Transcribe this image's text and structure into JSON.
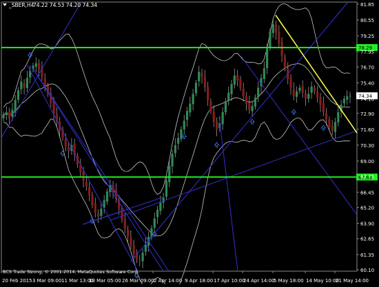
{
  "header": {
    "symbol_label": "_SBER,H4",
    "ohlc_label": "74.22 74.53 74.20 74.34",
    "menu_icon": "triangle-down-icon"
  },
  "footer": {
    "copyright": "BCS Trade Strong, © 2001-2014, MetaQuotes Software Corp."
  },
  "colors": {
    "background": "#000000",
    "frame": "#8a8a8a",
    "axis_text": "#ffffff",
    "bull_candle": "#2e8b57",
    "bear_candle": "#8b1a1a",
    "bollinger": "#c8c8c8",
    "fractal_arrow": "#3a6ad8",
    "trendline": "#3232d0",
    "level_line": "#22ee22",
    "level_label_bg": "#22ee22",
    "yellow_line": "#f3f34a",
    "price_label_bg": "#ffffff"
  },
  "chart_data": {
    "type": "candlestick",
    "symbol": "_SBER",
    "timeframe": "H4",
    "ylim": [
      60.1,
      81.9
    ],
    "y_ticks": [
      81.85,
      80.55,
      79.25,
      77.95,
      76.7,
      75.4,
      74.1,
      72.9,
      71.6,
      70.3,
      69.0,
      67.75,
      66.45,
      65.2,
      63.9,
      62.65,
      61.35,
      60.1
    ],
    "x_ticks": [
      "20 Feb 2015",
      "3 Mar 09:00",
      "11 Mar 13:00",
      "18 Mar 05:00",
      "26 Mar 09:00",
      "2 Apr 14:00",
      "9 Apr 18:00",
      "17 Apr 10:00",
      "24 Apr 14:00",
      "5 May 18:00",
      "14 May 10:00",
      "21 May 14:00"
    ],
    "closes": [
      72.8,
      73.0,
      72.5,
      73.2,
      74.0,
      74.8,
      75.5,
      75.0,
      75.8,
      76.4,
      76.8,
      77.0,
      76.5,
      75.9,
      75.2,
      74.5,
      73.8,
      72.9,
      72.2,
      71.5,
      70.9,
      70.2,
      69.8,
      70.3,
      69.5,
      68.7,
      68.1,
      67.4,
      66.9,
      66.2,
      65.4,
      64.8,
      64.5,
      65.1,
      65.8,
      66.5,
      67.0,
      66.5,
      65.9,
      65.1,
      64.2,
      63.5,
      62.8,
      62.1,
      61.4,
      60.9,
      60.8,
      61.5,
      62.2,
      62.8,
      63.5,
      64.3,
      65.0,
      65.6,
      66.0,
      67.4,
      68.6,
      69.6,
      70.3,
      70.9,
      71.6,
      72.3,
      73.1,
      73.7,
      74.5,
      75.4,
      76.3,
      75.9,
      75.0,
      74.0,
      73.1,
      72.2,
      71.6,
      72.1,
      73.0,
      73.9,
      74.6,
      75.3,
      76.0,
      75.6,
      75.0,
      74.3,
      73.7,
      73.2,
      73.5,
      74.2,
      75.0,
      75.8,
      76.6,
      78.2,
      79.6,
      80.2,
      79.5,
      78.6,
      77.6,
      76.6,
      75.7,
      75.0,
      74.3,
      74.7,
      75.0,
      74.6,
      74.1,
      74.5,
      75.1,
      74.7,
      74.2,
      73.6,
      73.0,
      72.4,
      71.8,
      71.5,
      72.2,
      73.0,
      73.6,
      74.1,
      74.3,
      74.34
    ],
    "current_price": "74.34",
    "levels": [
      {
        "label": "78.29",
        "value": 78.29
      },
      {
        "label": "67.69",
        "value": 67.69
      }
    ]
  }
}
